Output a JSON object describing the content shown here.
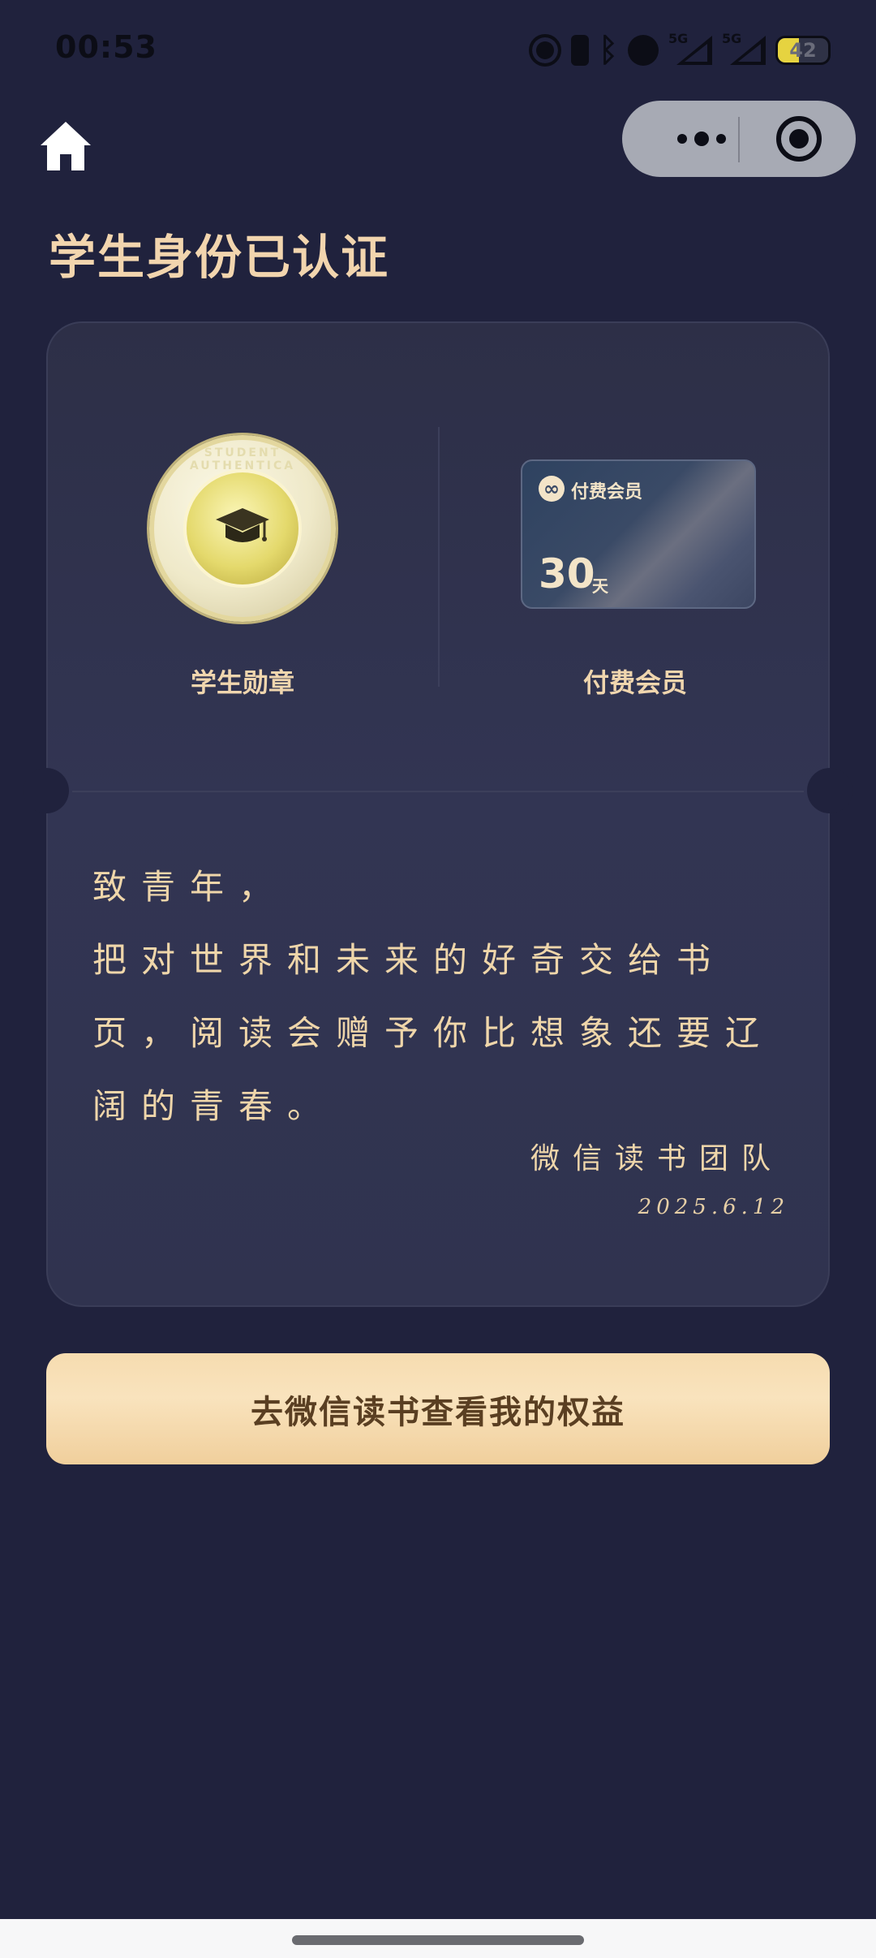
{
  "status_bar": {
    "time": "00:53",
    "network_tag_1": "5G",
    "network_tag_2": "5G",
    "battery_level": "42",
    "battery_fraction": 0.42,
    "icons": [
      "alarm-icon",
      "watch-icon",
      "bluetooth-icon",
      "notification-icon",
      "signal-icon",
      "signal-icon",
      "battery-icon"
    ]
  },
  "nav": {
    "home_icon": "home-icon",
    "more_icon": "more-dots-icon",
    "close_icon": "target-icon"
  },
  "page": {
    "title": "学生身份已认证"
  },
  "badges": {
    "medal_ring_text": "STUDENT AUTHENTICA",
    "medal_label": "学生勋章",
    "member_card_title": "付费会员",
    "member_card_days": "30",
    "member_card_unit": "天",
    "member_label": "付费会员"
  },
  "letter": {
    "line1": "致青年，",
    "line2": "把对世界和未来的好奇交给书",
    "line3": "页，阅读会赠予你比想象还要辽",
    "line4": "阔的青春。",
    "signature": "微信读书团队",
    "date": "2025.6.12"
  },
  "cta": {
    "label": "去微信读书查看我的权益"
  },
  "colors": {
    "background": "#20223d",
    "card": "#30334f",
    "gold_text": "#f0d6ae",
    "button_gradient_start": "#f6dcb0",
    "button_text": "#5a3f22"
  }
}
